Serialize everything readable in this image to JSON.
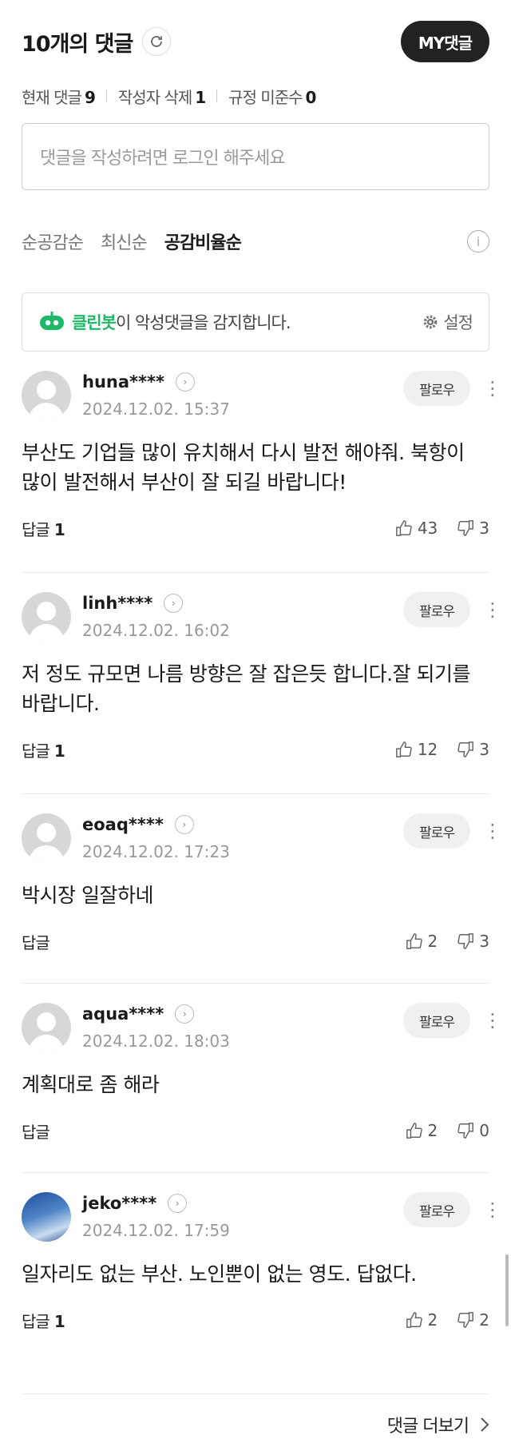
{
  "header": {
    "title": "10개의 댓글",
    "my_button": "MY댓글"
  },
  "stats": [
    {
      "label": "현재 댓글",
      "value": "9"
    },
    {
      "label": "작성자 삭제",
      "value": "1"
    },
    {
      "label": "규정 미준수",
      "value": "0"
    }
  ],
  "input": {
    "placeholder": "댓글을 작성하려면 로그인 해주세요"
  },
  "sort": {
    "options": [
      "순공감순",
      "최신순",
      "공감비율순"
    ],
    "selected": "공감비율순"
  },
  "cleanbot": {
    "name": "클린봇",
    "text": "이 악성댓글을 감지합니다.",
    "settings": "설정"
  },
  "comments": [
    {
      "user": "huna****",
      "date": "2024.12.02. 15:37",
      "text": "부산도 기업들 많이 유치해서 다시 발전 해야줘. 북항이 많이 발전해서 부산이 잘 되길 바랍니다!",
      "reply_label": "답글",
      "reply_count": "1",
      "likes": "43",
      "dislikes": "3",
      "follow": "팔로우"
    },
    {
      "user": "linh****",
      "date": "2024.12.02. 16:02",
      "text": "저 정도 규모면 나름 방향은 잘 잡은듯 합니다.잘 되기를 바랍니다.",
      "reply_label": "답글",
      "reply_count": "1",
      "likes": "12",
      "dislikes": "3",
      "follow": "팔로우"
    },
    {
      "user": "eoaq****",
      "date": "2024.12.02. 17:23",
      "text": "박시장 일잘하네",
      "reply_label": "답글",
      "reply_count": "",
      "likes": "2",
      "dislikes": "3",
      "follow": "팔로우"
    },
    {
      "user": "aqua****",
      "date": "2024.12.02. 18:03",
      "text": "계획대로 좀 해라",
      "reply_label": "답글",
      "reply_count": "",
      "likes": "2",
      "dislikes": "0",
      "follow": "팔로우"
    },
    {
      "user": "jeko****",
      "date": "2024.12.02. 17:59",
      "text": "일자리도 없는 부산. 노인뿐이 없는 영도. 답없다.",
      "reply_label": "답글",
      "reply_count": "1",
      "likes": "2",
      "dislikes": "2",
      "follow": "팔로우"
    }
  ],
  "footer": {
    "more": "댓글 더보기"
  }
}
